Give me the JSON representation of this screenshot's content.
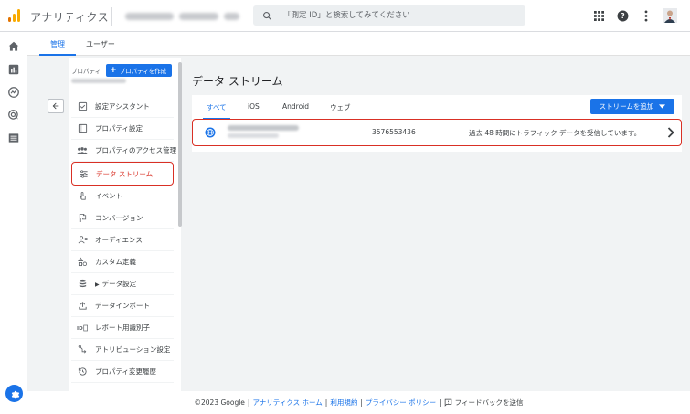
{
  "header": {
    "app_title": "アナリティクス",
    "search_placeholder": "「測定 ID」と検索してみてください"
  },
  "admin_tabs": [
    {
      "label": "管理",
      "active": true
    },
    {
      "label": "ユーザー",
      "active": false
    }
  ],
  "property": {
    "label": "プロパティ",
    "create_button": "プロパティを作成"
  },
  "nav": [
    {
      "label": "設定アシスタント",
      "icon": "checkbox-icon"
    },
    {
      "label": "プロパティ設定",
      "icon": "settings-square-icon"
    },
    {
      "label": "プロパティのアクセス管理",
      "icon": "people-icon"
    },
    {
      "label": "データ ストリーム",
      "icon": "stream-icon",
      "active": true
    },
    {
      "label": "イベント",
      "icon": "touch-icon"
    },
    {
      "label": "コンバージョン",
      "icon": "flag-icon"
    },
    {
      "label": "オーディエンス",
      "icon": "audience-icon"
    },
    {
      "label": "カスタム定義",
      "icon": "shapes-icon"
    },
    {
      "label": "データ設定",
      "icon": "database-icon",
      "expandable": true
    },
    {
      "label": "データインポート",
      "icon": "upload-icon"
    },
    {
      "label": "レポート用識別子",
      "icon": "id-icon"
    },
    {
      "label": "アトリビューション設定",
      "icon": "attribution-icon"
    },
    {
      "label": "プロパティ変更履歴",
      "icon": "history-icon"
    }
  ],
  "main": {
    "title": "データ ストリーム",
    "tabs": [
      {
        "label": "すべて",
        "active": true
      },
      {
        "label": "iOS",
        "active": false
      },
      {
        "label": "Android",
        "active": false
      },
      {
        "label": "ウェブ",
        "active": false
      }
    ],
    "add_stream_button": "ストリームを追加",
    "streams": [
      {
        "id": "3576553436",
        "status": "過去 48 時間にトラフィック データを受信しています。"
      }
    ]
  },
  "footer": {
    "copyright": "©2023 Google",
    "links": [
      "アナリティクス ホーム",
      "利用規約",
      "プライバシー ポリシー"
    ],
    "feedback": "フィードバックを送信"
  },
  "colors": {
    "accent": "#1a73e8",
    "highlight": "#d93025",
    "logo_orange": "#f9ab00",
    "logo_dark": "#e37400"
  }
}
